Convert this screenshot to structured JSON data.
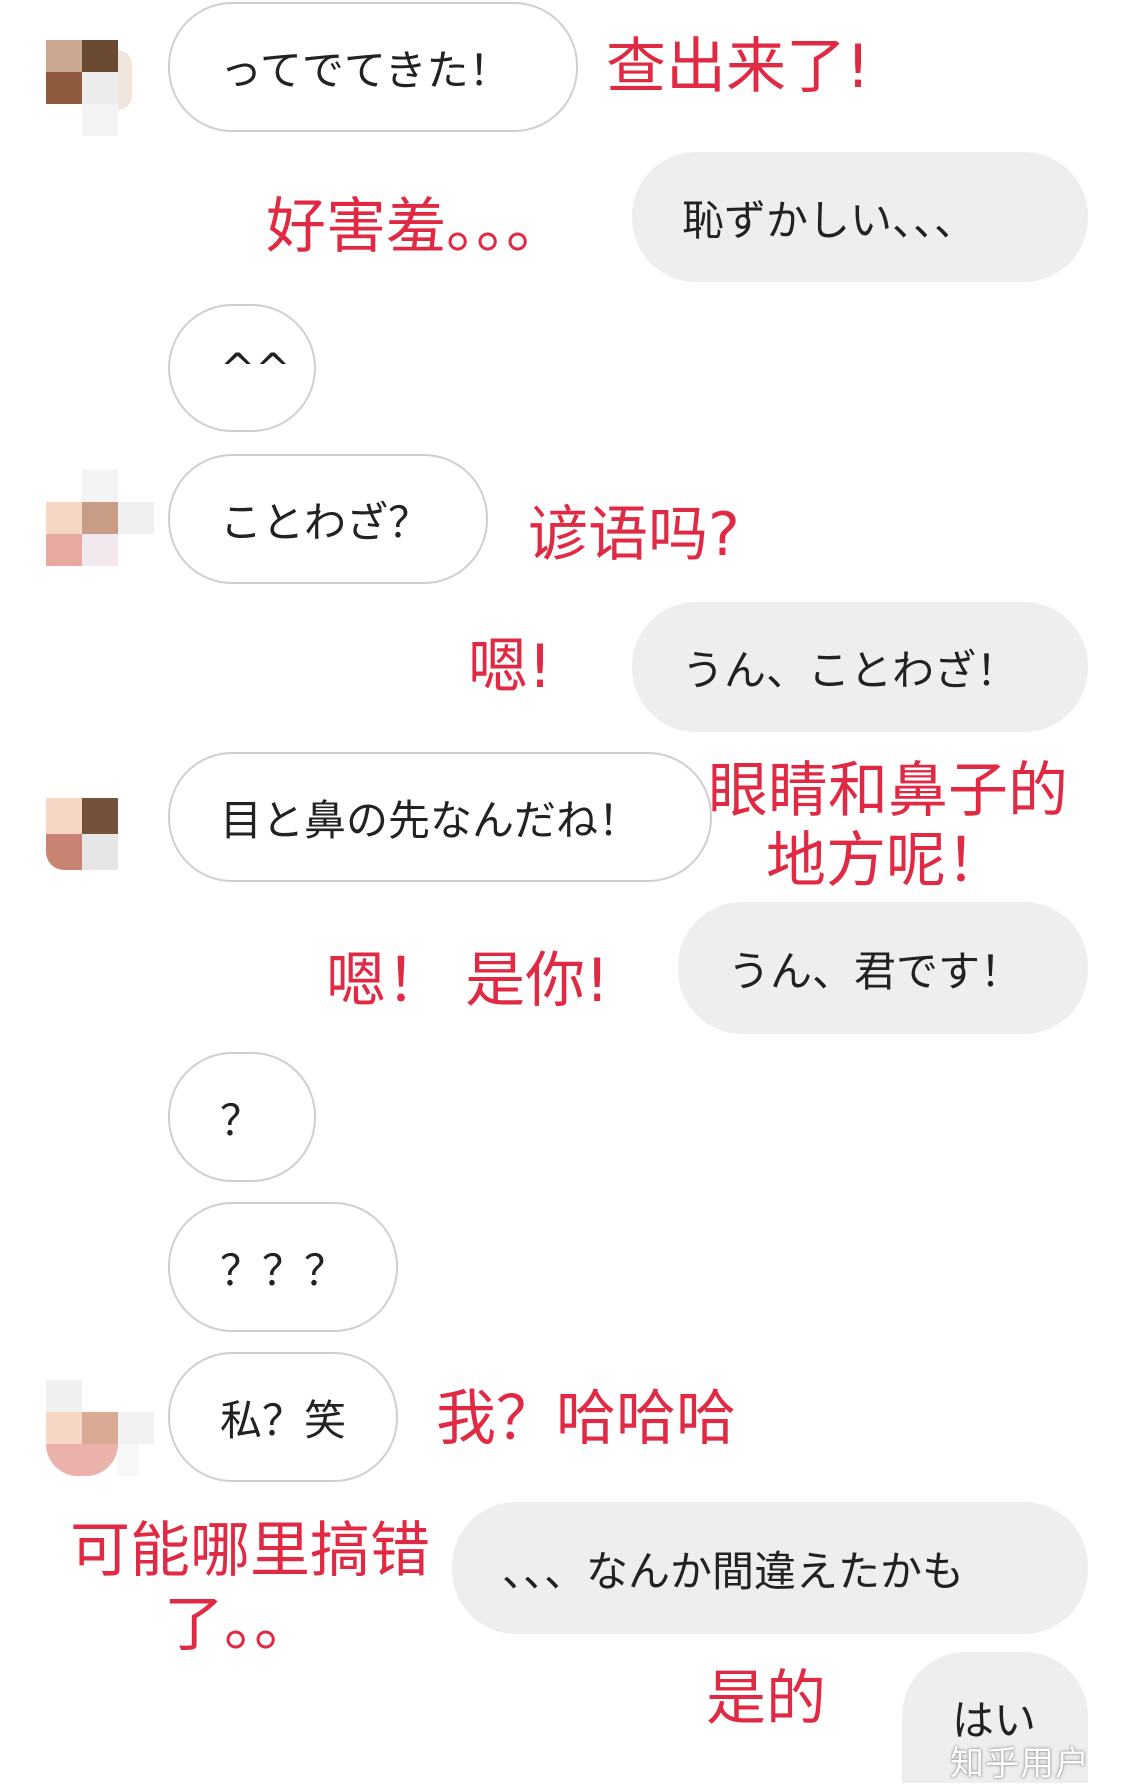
{
  "messages": [
    {
      "side": "received",
      "text": "ってでてきた！"
    },
    {
      "side": "sent",
      "text": "恥ずかしい、、、"
    },
    {
      "side": "received",
      "text": "^^"
    },
    {
      "side": "received",
      "text": "ことわざ？"
    },
    {
      "side": "sent",
      "text": "うん、ことわざ！"
    },
    {
      "side": "received",
      "text": "目と鼻の先なんだね！"
    },
    {
      "side": "sent",
      "text": "うん、君です！"
    },
    {
      "side": "received",
      "text": "？"
    },
    {
      "side": "received",
      "text": "？？？"
    },
    {
      "side": "received",
      "text": "私？笑"
    },
    {
      "side": "sent",
      "text": "、、、なんか間違えたかも"
    },
    {
      "side": "sent",
      "text": "はい"
    }
  ],
  "annotations": [
    "查出来了!",
    "好害羞。。。",
    "谚语吗?",
    "嗯!",
    "眼睛和鼻子的",
    "地方呢！",
    "嗯！ 是你!",
    "我？哈哈哈",
    "可能哪里搞错",
    "了。。",
    "是的"
  ],
  "watermark": "知乎用户",
  "colors": {
    "annotation": "#e02a44",
    "received_bubble_border": "#cfcfcf",
    "sent_bubble_bg": "#eeeeee",
    "text": "#222222"
  }
}
